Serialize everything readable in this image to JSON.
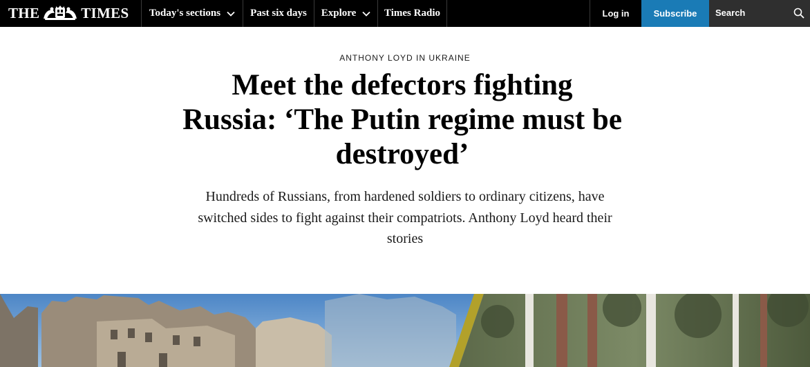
{
  "nav": {
    "logo_left": "THE",
    "logo_right": "TIMES",
    "crest_icon": "royal-crest-icon",
    "items": [
      {
        "label": "Today's sections",
        "has_dropdown": true
      },
      {
        "label": "Past six days",
        "has_dropdown": false
      },
      {
        "label": "Explore",
        "has_dropdown": true
      },
      {
        "label": "Times Radio",
        "has_dropdown": false
      }
    ],
    "login_label": "Log in",
    "subscribe_label": "Subscribe",
    "search_label": "Search",
    "colors": {
      "bar": "#000000",
      "subscribe": "#1a7bb6",
      "search": "#2f2f2f"
    }
  },
  "article": {
    "kicker": "ANTHONY LOYD IN UKRAINE",
    "headline": "Meet the defectors fighting Russia: ‘The Putin regime must be destroyed’",
    "standfirst": "Hundreds of Russians, from hardened soldiers to ordinary citizens, have switched sides to fight against their compatriots. Anthony Loyd heard their stories"
  }
}
